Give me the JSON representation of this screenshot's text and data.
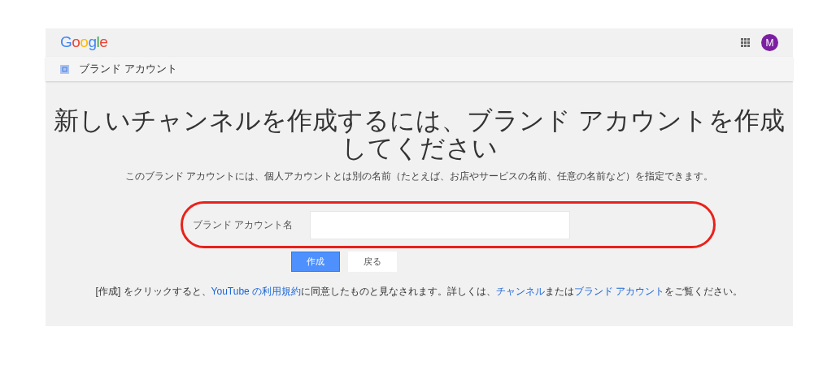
{
  "header": {
    "logo": "Google",
    "avatar": "M"
  },
  "subheader": {
    "title": "ブランド アカウント"
  },
  "heading": "新しいチャンネルを作成するには、ブランド アカウントを作成してください",
  "description": "このブランド アカウントには、個人アカウントとは別の名前（たとえば、お店やサービスの名前、任意の名前など）を指定できます。",
  "form": {
    "label": "ブランド アカウント名",
    "highlighted": true
  },
  "buttons": [
    {
      "label": "作成",
      "kind": "primary"
    },
    {
      "label": "戻る",
      "kind": "secondary"
    }
  ],
  "footer": [
    {
      "kind": "text",
      "text": "[作成] をクリックすると、"
    },
    {
      "kind": "link",
      "text": "YouTube の利用規約"
    },
    {
      "kind": "text",
      "text": "に同意したものと見なされます。詳しくは、"
    },
    {
      "kind": "link",
      "text": "チャンネル"
    },
    {
      "kind": "text",
      "text": "または"
    },
    {
      "kind": "link",
      "text": "ブランド アカウント"
    },
    {
      "kind": "text",
      "text": "をご覧ください。"
    }
  ]
}
